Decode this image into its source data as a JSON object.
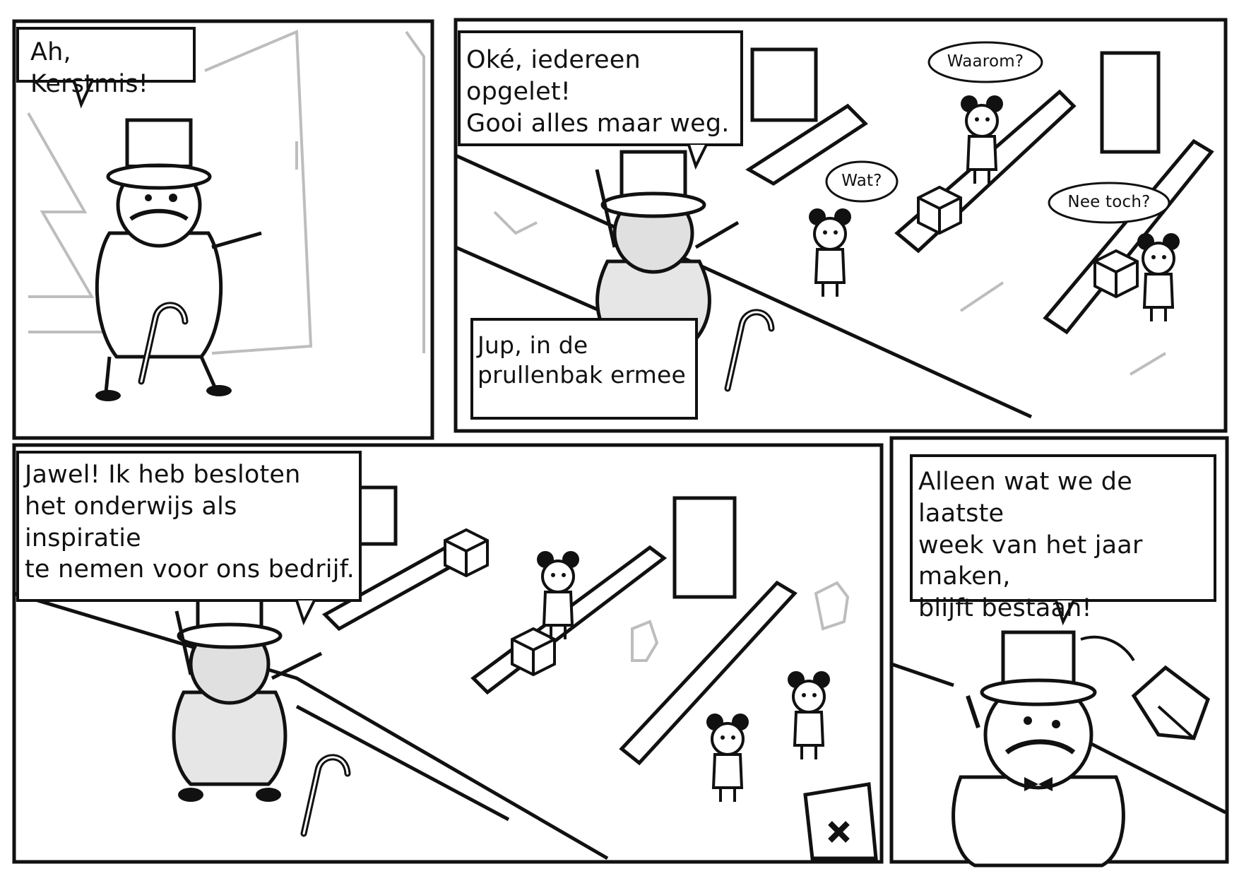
{
  "comic": {
    "panel1": {
      "speech": "Ah, Kerstmis!"
    },
    "panel2": {
      "boss_speech": "Oké, iedereen opgelet!\nGooi alles maar weg.",
      "worker_speech_1": "Waarom?",
      "worker_speech_2": "Wat?",
      "worker_speech_3": "Nee toch?",
      "caption": "Jup, in de\nprullenbak ermee"
    },
    "panel3": {
      "speech": "Jawel! Ik heb besloten\nhet onderwijs als inspiratie\nte nemen voor ons bedrijf."
    },
    "panel4": {
      "speech": "Alleen wat we de laatste\nweek van het jaar maken,\nblijft bestaan!"
    }
  },
  "colors": {
    "ink": "#111111",
    "shade": "#cfcfcf",
    "light": "#bdbdbd",
    "paper": "#ffffff"
  }
}
